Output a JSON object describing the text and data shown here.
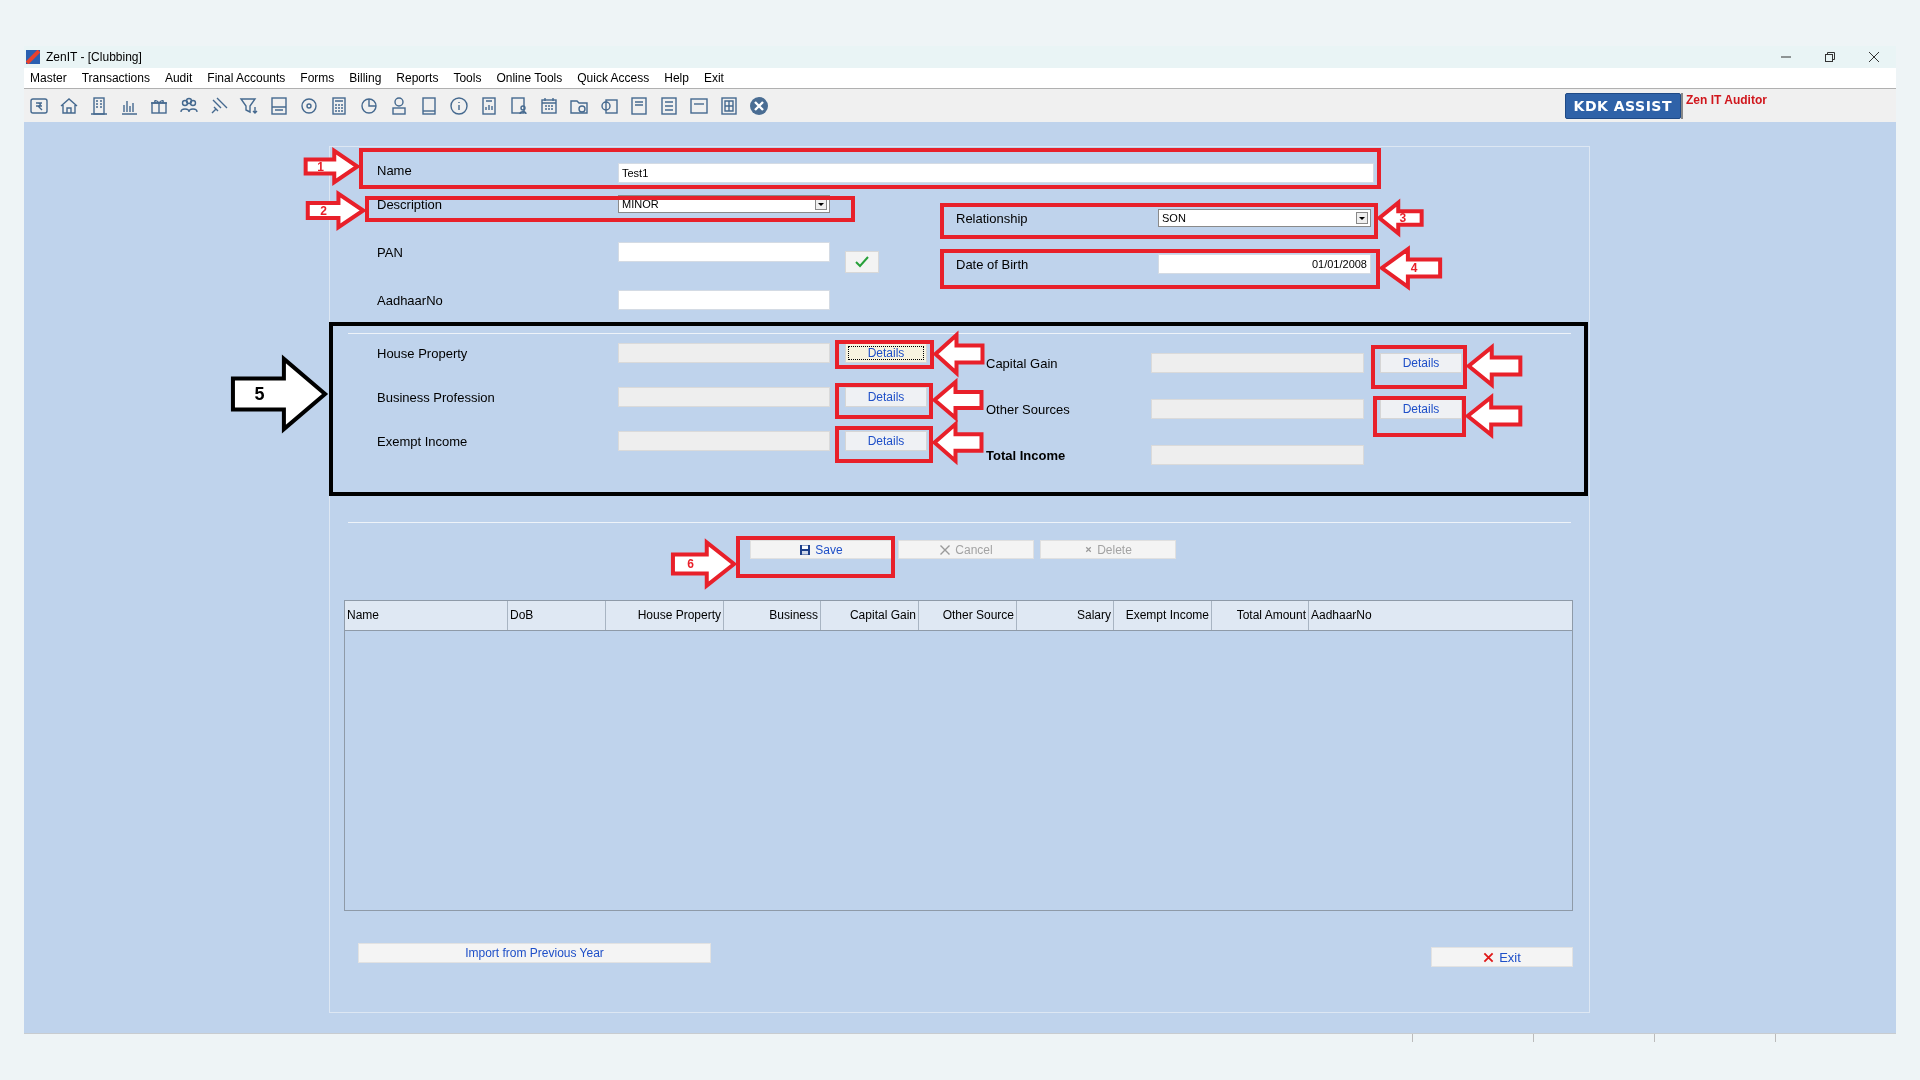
{
  "window": {
    "title": "ZenIT - [Clubbing]"
  },
  "menu": [
    "Master",
    "Transactions",
    "Audit",
    "Final Accounts",
    "Forms",
    "Billing",
    "Reports",
    "Tools",
    "Online Tools",
    "Quick Access",
    "Help",
    "Exit"
  ],
  "toolbar": {
    "assist_button": "KDK ASSIST",
    "product_label": "Zen IT Auditor"
  },
  "form": {
    "name": {
      "label": "Name",
      "value": "Test1"
    },
    "description": {
      "label": "Description",
      "value": "MINOR"
    },
    "pan": {
      "label": "PAN"
    },
    "aadhaar": {
      "label": "AadhaarNo"
    },
    "relationship": {
      "label": "Relationship",
      "value": "SON"
    },
    "date_of_birth": {
      "label": "Date of Birth",
      "value": "01/01/2008"
    }
  },
  "income_left": [
    {
      "label": "House Property",
      "details_button": "Details",
      "focused": true
    },
    {
      "label": "Business Profession",
      "details_button": "Details",
      "focused": false
    },
    {
      "label": "Exempt Income",
      "details_button": "Details",
      "focused": false
    }
  ],
  "income_right": [
    {
      "label": "Capital Gain",
      "kind": "amount",
      "details_button": "Details"
    },
    {
      "label": "Other Sources",
      "kind": "amount",
      "details_button": "Details"
    },
    {
      "label": "Total Income",
      "kind": "total"
    }
  ],
  "actions": [
    {
      "label": "Save",
      "disabled": false
    },
    {
      "label": "Cancel",
      "disabled": true
    },
    {
      "label": "Delete",
      "disabled": true
    }
  ],
  "table": {
    "columns": [
      {
        "label": "Name"
      },
      {
        "label": "DoB"
      },
      {
        "label": "House Property"
      },
      {
        "label": "Business"
      },
      {
        "label": "Capital Gain"
      },
      {
        "label": "Other Source"
      },
      {
        "label": "Salary"
      },
      {
        "label": "Exempt Income"
      },
      {
        "label": "Total Amount"
      },
      {
        "label": "AadhaarNo"
      }
    ]
  },
  "footer": {
    "import_button": "Import from Previous Year",
    "exit_button": "Exit"
  },
  "annotations": {
    "callouts": [
      {
        "label": "1",
        "color": "#e8202a"
      },
      {
        "label": "2",
        "color": "#e8202a"
      },
      {
        "label": "3",
        "color": "#e8202a"
      },
      {
        "label": "4",
        "color": "#e8202a"
      },
      {
        "label": "5",
        "color": "#000000"
      },
      {
        "label": "6",
        "color": "#e8202a"
      }
    ]
  }
}
